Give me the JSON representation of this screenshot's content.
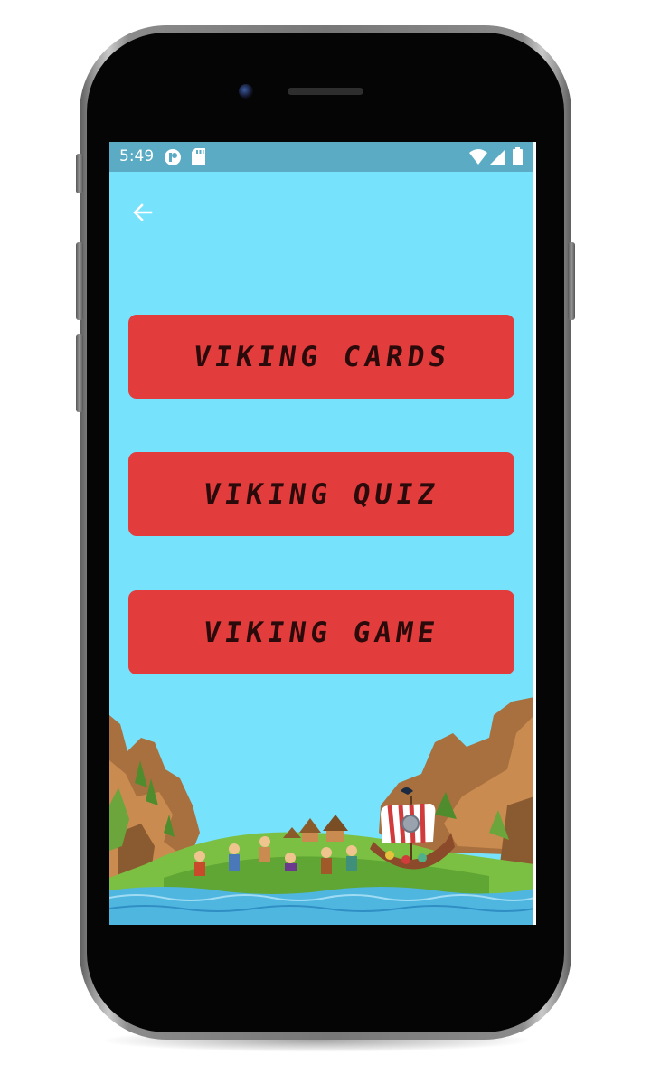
{
  "status_bar": {
    "time": "5:49",
    "icons": [
      "app-notification-icon",
      "sd-card-icon",
      "wifi-icon",
      "cell-signal-icon",
      "battery-icon"
    ]
  },
  "toolbar": {
    "back_icon": "arrow-left-icon"
  },
  "menu": {
    "buttons": [
      {
        "label": "VIKING CARDS"
      },
      {
        "label": "VIKING QUIZ"
      },
      {
        "label": "VIKING GAME"
      }
    ]
  },
  "colors": {
    "screen_background": "#77e2fb",
    "status_bar": "#5aabc3",
    "button": "#e23c3c",
    "button_text": "#2a0a0a"
  }
}
